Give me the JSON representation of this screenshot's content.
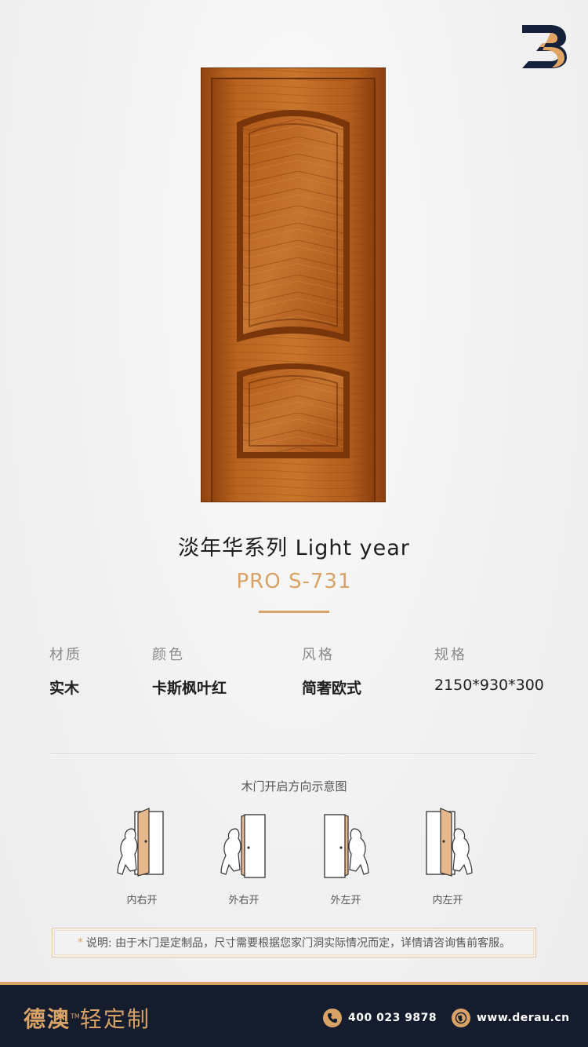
{
  "colors": {
    "accent": "#d9a368",
    "footer_bg": "#141c2e",
    "wood": "#b5601e"
  },
  "product": {
    "series_title": "淡年华系列  Light year",
    "model": "PRO S-731"
  },
  "specs": [
    {
      "label": "材质",
      "value": "实木"
    },
    {
      "label": "颜色",
      "value": "卡斯枫叶红"
    },
    {
      "label": "风格",
      "value": "简奢欧式"
    },
    {
      "label": "规格",
      "value": "2150*930*300"
    }
  ],
  "diagram": {
    "title": "木门开启方向示意图",
    "openings": [
      {
        "label": "内右开",
        "icon": "door-inward-right-icon"
      },
      {
        "label": "外右开",
        "icon": "door-outward-right-icon"
      },
      {
        "label": "外左开",
        "icon": "door-outward-left-icon"
      },
      {
        "label": "内左开",
        "icon": "door-inward-left-icon"
      }
    ]
  },
  "note": {
    "star": "*",
    "text": "说明: 由于木门是定制品，尺寸需要根据您家门洞实际情况而定，详情请咨询售前客服。"
  },
  "footer": {
    "brand_main": "德澳",
    "brand_tm": "TM",
    "brand_sub": "轻定制",
    "phone": "400 023 9878",
    "website": "www.derau.cn",
    "phone_icon": "phone-icon",
    "web_icon": "globe-icon"
  },
  "logo": {
    "icon": "brand-logo-icon"
  }
}
